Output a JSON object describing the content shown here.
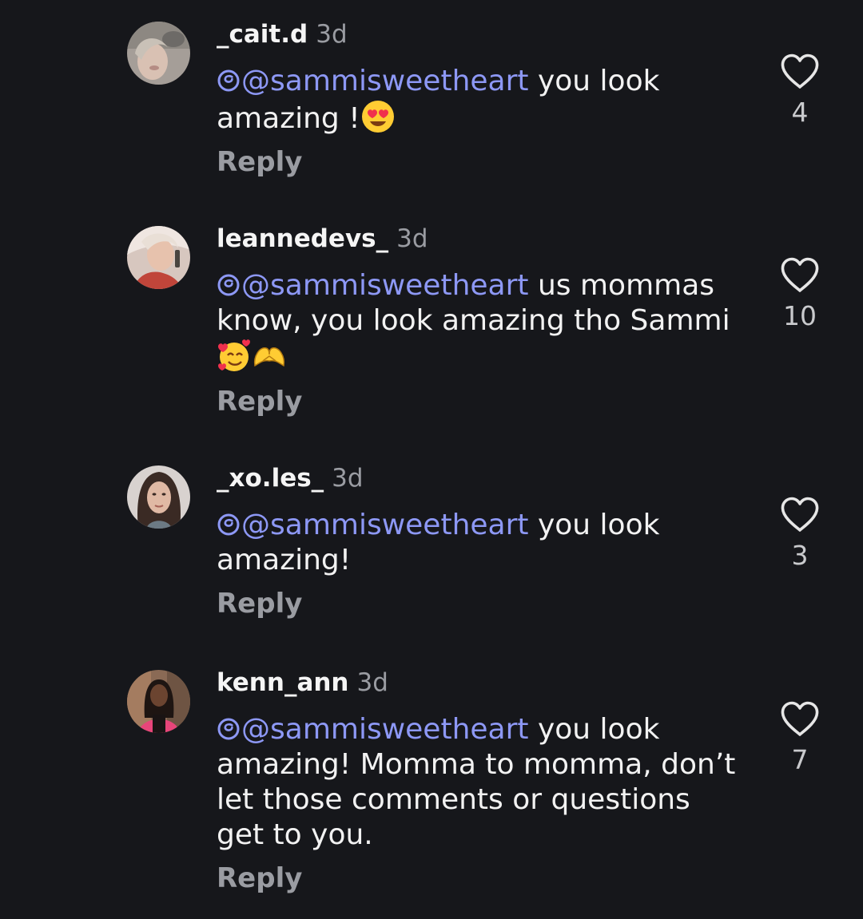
{
  "comments": [
    {
      "username": "_cait.d",
      "age": "3d",
      "mention": "@sammisweetheart",
      "text": " you look amazing !",
      "reply_label": "Reply",
      "likes": "4"
    },
    {
      "username": "leannedevs_",
      "age": "3d",
      "mention": "@sammisweetheart",
      "text": " us mommas know, you look amazing tho Sammi",
      "reply_label": "Reply",
      "likes": "10"
    },
    {
      "username": "_xo.les_",
      "age": "3d",
      "mention": "@sammisweetheart",
      "text": " you look amazing!",
      "reply_label": "Reply",
      "likes": "3"
    },
    {
      "username": "kenn_ann",
      "age": "3d",
      "mention": "@sammisweetheart",
      "text": " you look amazing! Momma to momma, don’t let those comments or questions get to you.",
      "reply_label": "Reply",
      "likes": "7"
    }
  ],
  "colors": {
    "background": "#16171b",
    "mention": "#8d98f5",
    "muted": "#9a9ca2",
    "text": "#f2f2f2"
  },
  "icons": {
    "like": "heart-outline-icon",
    "mention_prefix": "threads-icon",
    "emoji_1": "heart-eyes-emoji",
    "emoji_2": "smiling-face-with-hearts-emoji",
    "emoji_3": "heart-hands-emoji"
  }
}
